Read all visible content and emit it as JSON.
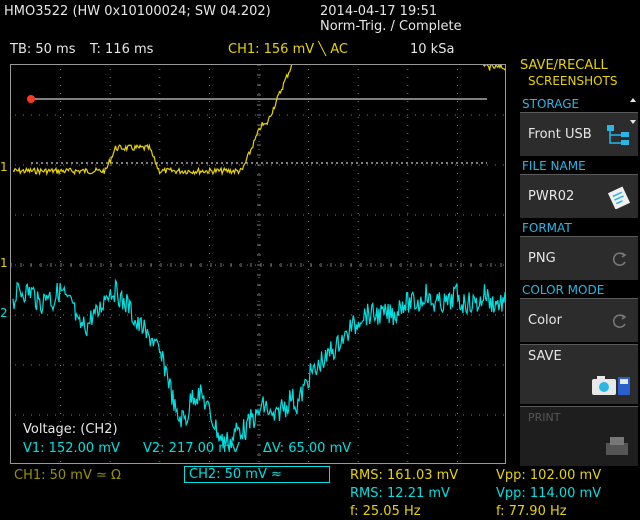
{
  "header": {
    "model": "HMO3522 (HW 0x10100024; SW 04.202)",
    "datetime": "2014-04-17 19:51",
    "status": "Norm-Trig. / Complete"
  },
  "info": {
    "timebase": "TB: 50 ms",
    "trigger_time": "T: 116 ms",
    "ch1_setting": "CH1: 156 mV ╲ AC",
    "samplerate": "10 kSa"
  },
  "screen": {
    "cursor_title": "Voltage: (CH2)",
    "v1": "V1: 152.00 mV",
    "v2": "V2: 217.00 mV",
    "dv": "ΔV: 65.00 mV",
    "marker_ch1": "1",
    "marker_ch2": "2",
    "marker_trig": "1"
  },
  "side": {
    "title_line1": "SAVE/RECALL",
    "title_line2": "SCREENSHOTS",
    "storage_head": "STORAGE",
    "storage_value": "Front USB",
    "filename_head": "FILE NAME",
    "filename_value": "PWR02",
    "format_head": "FORMAT",
    "format_value": "PNG",
    "colormode_head": "COLOR MODE",
    "colormode_value": "Color",
    "save_label": "SAVE",
    "print_label": "PRINT"
  },
  "bottom": {
    "ch1_scale": "CH1: 50 mV ≃ Ω",
    "ch2_scale": "CH2: 50 mV ≈",
    "rms1": "RMS: 161.03 mV",
    "rms2": "RMS: 12.21 mV",
    "freq1": "f: 25.05 Hz",
    "vpp1": "Vpp: 102.00 mV",
    "vpp2": "Vpp: 114.00 mV",
    "freq2": "f: 77.90 Hz"
  },
  "colors": {
    "ch1": "#e8d400",
    "ch2": "#00e0e0",
    "accent": "#2ab7e6",
    "cursor_marker": "#ff3b1f",
    "grid": "#7a7a7a"
  },
  "chart_data": {
    "type": "line",
    "grid": true,
    "series": [
      {
        "values": [
          0,
          0,
          0,
          0,
          0,
          0,
          0,
          0,
          0,
          0,
          0,
          0,
          0,
          0,
          0,
          0,
          0,
          0,
          0,
          0,
          0.5,
          1,
          1,
          1,
          1,
          1,
          1,
          1,
          1,
          0.5,
          0,
          0,
          0,
          0,
          0,
          0,
          0,
          0,
          0,
          0,
          0,
          0,
          0,
          0,
          0,
          0,
          0,
          0,
          0.5,
          1,
          1.5,
          2,
          2,
          2.5,
          3,
          3.5,
          4,
          4.5,
          5,
          5.5,
          6,
          6.5,
          7,
          7,
          7.5,
          7.5,
          7.5,
          7,
          7,
          7.5,
          8,
          8.5,
          8,
          7.5,
          7.5,
          8,
          8,
          8.5,
          8.5,
          8.5,
          8,
          8,
          7.5,
          7.5,
          8,
          8.5,
          8,
          7,
          7,
          6.5,
          6,
          6,
          5.5,
          5.5,
          5,
          5.5,
          5,
          4.5,
          4.5,
          4.5,
          4.5,
          4.5
        ]
      },
      {
        "values": [
          0,
          0.5,
          0.5,
          0.5,
          0.5,
          0,
          0,
          0.5,
          0,
          0.5,
          0.5,
          0,
          0,
          -1,
          -1,
          -1,
          -0.5,
          -0.5,
          0,
          0.5,
          0.5,
          0.5,
          0,
          0,
          -0.5,
          -1,
          -1,
          -1.5,
          -1.5,
          -2,
          -2.5,
          -3,
          -4,
          -5,
          -5,
          -5,
          -4,
          -4,
          -4,
          -4.5,
          -5,
          -5.5,
          -6,
          -6,
          -6,
          -5.5,
          -5.5,
          -5.5,
          -5,
          -5,
          -4.5,
          -4.5,
          -5,
          -5,
          -4.5,
          -4.5,
          -4,
          -4.5,
          -4,
          -3.5,
          -3,
          -3,
          -2.5,
          -2.5,
          -2,
          -2,
          -1.5,
          -1.5,
          -1,
          -1,
          -0.5,
          -0.5,
          -0.5,
          -0.5,
          -0.5,
          -0.5,
          -0.5,
          -0.5,
          0,
          0,
          0,
          0,
          0,
          0.5,
          0,
          0,
          0,
          0,
          0,
          0.5,
          0,
          0,
          0,
          0,
          0,
          0.5,
          0,
          0,
          0,
          0
        ]
      }
    ]
  }
}
